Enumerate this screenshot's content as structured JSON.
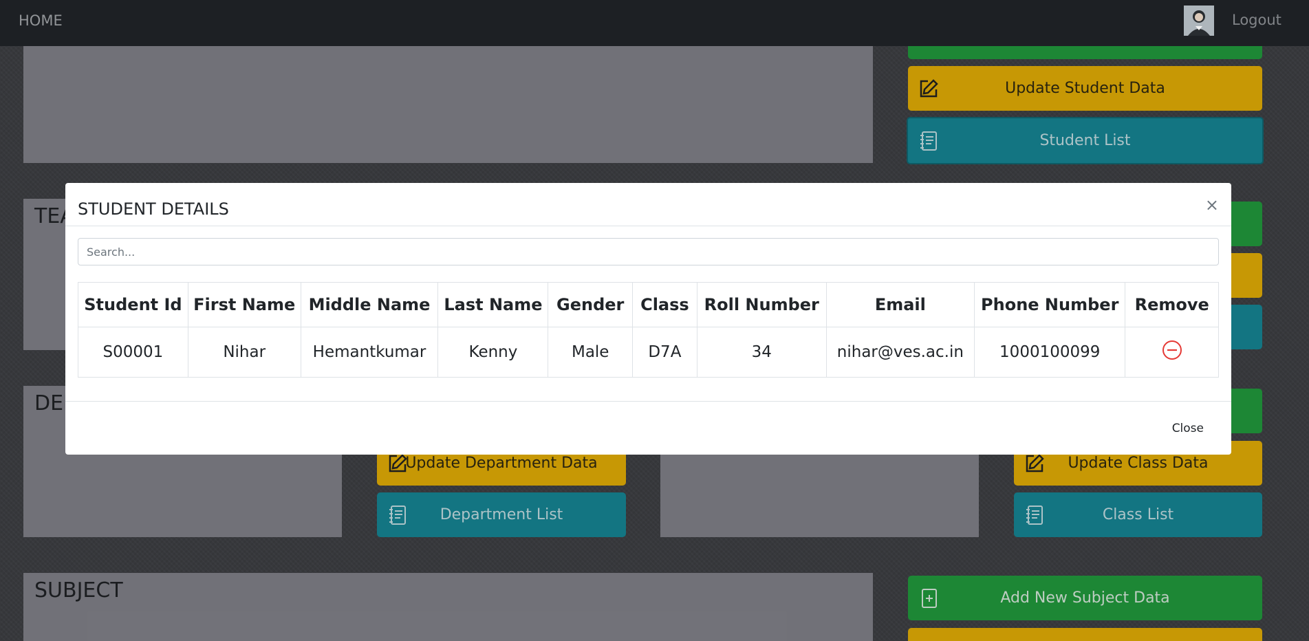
{
  "navbar": {
    "home_label": "HOME",
    "logout_label": "Logout"
  },
  "sections": {
    "teacher_title": "TEA",
    "department_title": "DEI",
    "subject_title": "SUBJECT"
  },
  "buttons": {
    "update_student": "Update Student Data",
    "student_list": "Student List",
    "update_department": "Update Department Data",
    "department_list": "Department List",
    "update_class": "Update Class Data",
    "class_list": "Class List",
    "add_subject": "Add New Subject Data"
  },
  "modal": {
    "title": "STUDENT DETAILS",
    "close_x": "×",
    "search_placeholder": "Search...",
    "table": {
      "headers": [
        "Student Id",
        "First Name",
        "Middle Name",
        "Last Name",
        "Gender",
        "Class",
        "Roll Number",
        "Email",
        "Phone Number",
        "Remove"
      ],
      "rows": [
        [
          "S00001",
          "Nihar",
          "Hemantkumar",
          "Kenny",
          "Male",
          "D7A",
          "34",
          "nihar@ves.ac.in",
          "1000100099"
        ]
      ]
    },
    "close_label": "Close"
  },
  "colors": {
    "green": "#1f8f38",
    "yellow": "#d2a106",
    "teal": "#157c8a",
    "remove_red": "#e53935"
  },
  "icons": [
    "edit-icon",
    "list-icon",
    "add-icon",
    "remove-icon",
    "close-icon",
    "avatar"
  ]
}
